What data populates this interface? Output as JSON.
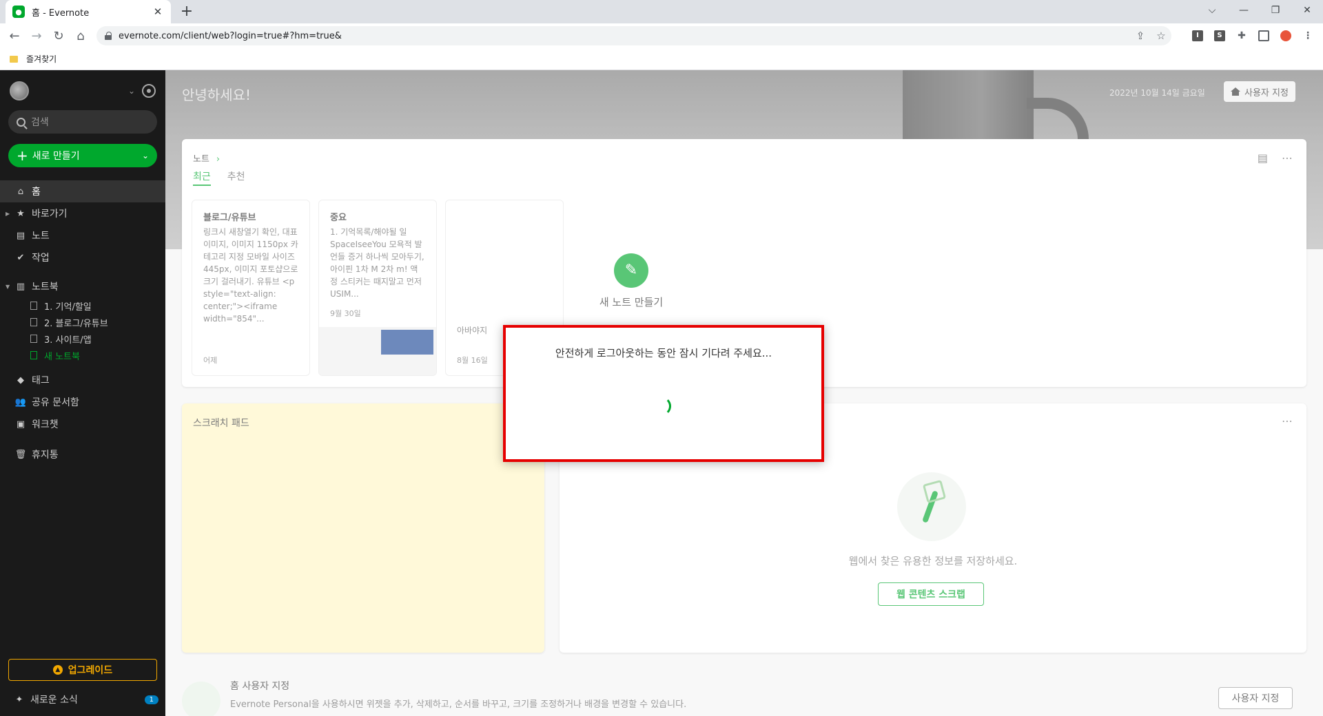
{
  "browser": {
    "tab_title": "홈 - Evernote",
    "tab_close": "✕",
    "new_tab": "+",
    "url": "evernote.com/client/web?login=true#?hm=true&",
    "bookmark_folder": "즐겨찾기",
    "window_controls": [
      "⌵",
      "—",
      "❐",
      "✕"
    ]
  },
  "sidebar": {
    "search_placeholder": "검색",
    "new_button": "새로 만들기",
    "items": [
      {
        "label": "홈",
        "icon": "home-icon",
        "active": true
      },
      {
        "label": "바로가기",
        "icon": "star-icon"
      },
      {
        "label": "노트",
        "icon": "note-icon"
      },
      {
        "label": "작업",
        "icon": "check-icon"
      },
      {
        "label": "노트북",
        "icon": "notebook-icon"
      },
      {
        "label": "태그",
        "icon": "tag-icon"
      },
      {
        "label": "공유 문서함",
        "icon": "people-icon"
      },
      {
        "label": "워크챗",
        "icon": "chat-icon"
      },
      {
        "label": "휴지통",
        "icon": "trash-icon"
      }
    ],
    "notebooks": [
      "1. 기억/할일",
      "2. 블로그/유튜브",
      "3. 사이트/앱",
      "새 노트북"
    ],
    "upgrade": "업그레이드",
    "news": "새로운 소식",
    "news_badge": "1"
  },
  "hero": {
    "greeting": "안녕하세요!",
    "date": "2022년 10월 14일 금요일",
    "customize_button": "사용자 지정"
  },
  "notes_widget": {
    "title": "노트",
    "tabs": [
      "최근",
      "추천"
    ],
    "notes": [
      {
        "title": "블로그/유튜브",
        "body": "링크시 새창열기 확인, 대표이미지, 이미지 1150px 카테고리 지정 모바일 사이즈 445px, 이미지 포토샵으로 크기 걸러내기. 유튜브 <p style=\"text-align: center;\"><iframe width=\"854\"...",
        "date": "어제"
      },
      {
        "title": "중요",
        "body": "1. 기억목록/해야될 일 SpaceIseeYou 모욕적 발언들 증거 하나씩 모아두기, 아이핀 1차 M 2차 m! 액정 스티커는 때지말고 먼저 USIM...",
        "date": "9월 30일"
      },
      {
        "title": "",
        "body": "아바야지",
        "date": "8월 16일"
      }
    ],
    "new_note": "새 노트 만들기"
  },
  "scratch": {
    "title": "스크래치 패드"
  },
  "clipper": {
    "text": "웹에서 찾은 유용한 정보를 저장하세요.",
    "button": "웹 콘텐츠 스크랩"
  },
  "customize": {
    "title": "홈 사용자 지정",
    "desc": "Evernote Personal을 사용하시면 위젯을 추가, 삭제하고, 순서를 바꾸고, 크기를 조정하거나 배경을 변경할 수 있습니다.",
    "button": "사용자 지정"
  },
  "modal": {
    "message": "안전하게 로그아웃하는 동안 잠시 기다려 주세요...",
    "border_color": "#e60000",
    "spinner_color": "#00a82d"
  }
}
